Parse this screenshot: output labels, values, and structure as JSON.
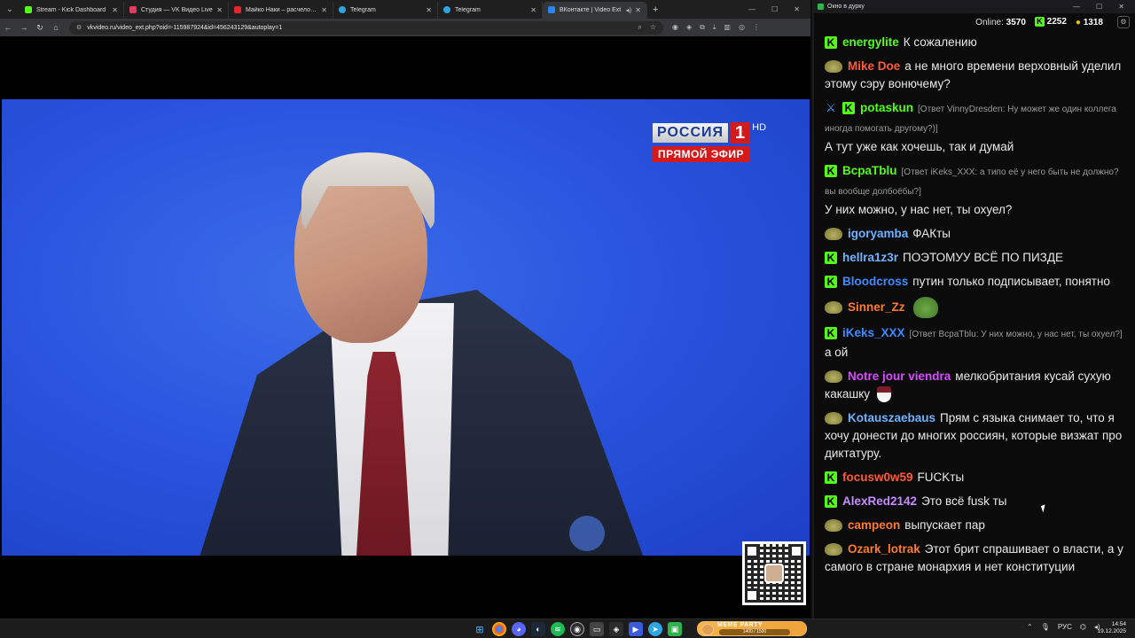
{
  "browser": {
    "tabs": [
      {
        "title": "Stream - Kick Dashboard",
        "color": "#53fc18",
        "active": false
      },
      {
        "title": "Студия — VK Видео Live",
        "color": "#e33b5f",
        "active": false
      },
      {
        "title": "Майко Наки – расчеловечивание",
        "color": "#e3262b",
        "active": false
      },
      {
        "title": "Telegram",
        "color": "#2ea5e0",
        "active": false
      },
      {
        "title": "Telegram",
        "color": "#2ea5e0",
        "active": false
      },
      {
        "title": "ВКонтакте | Video Ext",
        "color": "#2787f5",
        "active": true
      }
    ],
    "url": "vkvideo.ru/video_ext.php?oid=-115987924&id=456243129&autoplay=1"
  },
  "video": {
    "channel_name": "РОССИЯ",
    "channel_number": "1",
    "hd": "HD",
    "live_label": "ПРЯМОЙ ЭФИР"
  },
  "chat": {
    "window_title": "Окно в дурку",
    "online_label": "Online:",
    "online_count": "3570",
    "kick_count": "2252",
    "vk_count": "1318",
    "messages": [
      {
        "badge": "kick",
        "user": "energylite",
        "color": "#53fc18",
        "reply": "",
        "text": "К сожалению",
        "emote": ""
      },
      {
        "badge": "frog",
        "user": "Mike Doe",
        "color": "#ff5b35",
        "reply": "",
        "text": "а не много времени верховный уделил этому сэру вонючему?",
        "emote": ""
      },
      {
        "badge": "sword",
        "user": "potaskun",
        "color": "#53fc18",
        "reply": "[Ответ VinnyDresden: Ну может же один коллега иногда помогать другому?)]",
        "text": "А тут уже как хочешь, так и думай",
        "emote": ""
      },
      {
        "badge": "kick",
        "user": "BcpaTblu",
        "color": "#53fc18",
        "reply": "[Ответ iKeks_XXX: а типо её у него быть не должно? вы вообще долбоёбы?]",
        "text": "У них можно, у нас нет, ты охуел?",
        "emote": ""
      },
      {
        "badge": "frog",
        "user": "igoryamba",
        "color": "#6fb2ff",
        "reply": "",
        "text": "ФАКты",
        "emote": ""
      },
      {
        "badge": "kick",
        "user": "hellra1z3r",
        "color": "#6fb2ff",
        "reply": "",
        "text": "ПОЭТОМУУ ВСЁ ПО ПИЗДЕ",
        "emote": ""
      },
      {
        "badge": "kick",
        "user": "Bloodcross",
        "color": "#3d8bff",
        "reply": "",
        "text": "путин только подписывает, понятно",
        "emote": ""
      },
      {
        "badge": "frog",
        "user": "Sinner_Zz",
        "color": "#ff7a2e",
        "reply": "",
        "text": "",
        "emote": "frog"
      },
      {
        "badge": "kick",
        "user": "iKeks_XXX",
        "color": "#3d8bff",
        "reply": "[Ответ BcpaTblu: У них можно, у нас нет, ты охуел?]",
        "text": "а ой",
        "emote": ""
      },
      {
        "badge": "frog",
        "user": "Notre jour viendra",
        "color": "#d94cff",
        "reply": "",
        "text": "мелкобритания кусай сухую какашку",
        "emote": "cup"
      },
      {
        "badge": "frog",
        "user": "Kotauszaebaus",
        "color": "#6fb2ff",
        "reply": "",
        "text": "Прям с языка снимает то, что я хочу донести до многих россиян, которые визжат про диктатуру.",
        "emote": ""
      },
      {
        "badge": "kick",
        "user": "focusw0w59",
        "color": "#ff5b35",
        "reply": "",
        "text": "FUCKты",
        "emote": ""
      },
      {
        "badge": "kick",
        "user": "AlexRed2142",
        "color": "#c58cff",
        "reply": "",
        "text": "Это всё fusk ты",
        "emote": ""
      },
      {
        "badge": "frog",
        "user": "campeon",
        "color": "#ff7a2e",
        "reply": "",
        "text": "выпускает пар",
        "emote": ""
      },
      {
        "badge": "frog",
        "user": "Ozark_lotrak",
        "color": "#ff7a2e",
        "reply": "",
        "text": "Этот брит спрашивает о власти, а у самого в стране монархия и нет конституции",
        "emote": ""
      }
    ]
  },
  "taskbar": {
    "pill_title": "MEME PARTY",
    "pill_progress_text": "1400 / 1500",
    "lang": "РУС",
    "time": "14:54",
    "date": "19.12.2025"
  }
}
